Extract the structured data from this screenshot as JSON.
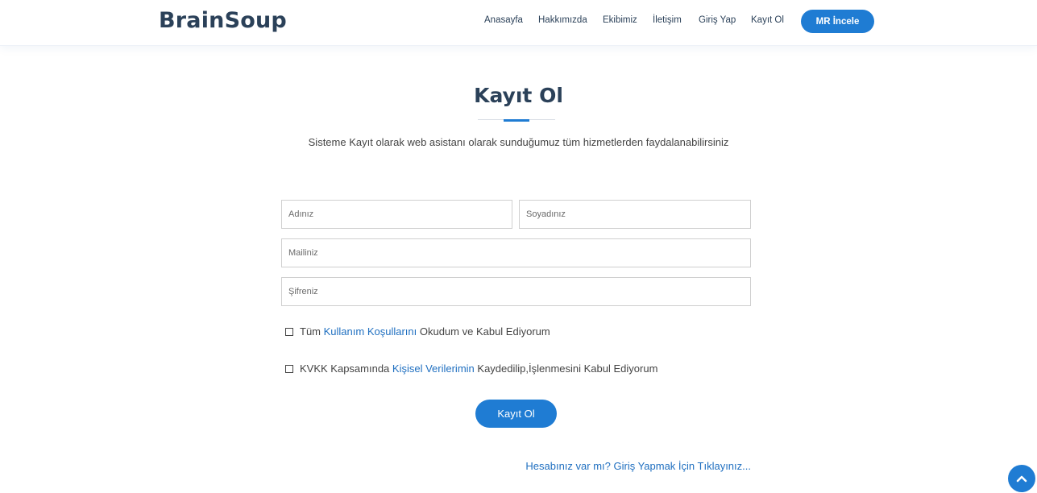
{
  "header": {
    "logo": "BrainSoup",
    "nav": [
      "Anasayfa",
      "Hakkımızda",
      "Ekibimiz",
      "İletişim",
      "Giriş Yap",
      "Kayıt Ol"
    ],
    "cta_label": "MR İncele"
  },
  "main": {
    "title": "Kayıt Ol",
    "subtitle": "Sisteme Kayıt olarak web asistanı olarak sunduğumuz tüm hizmetlerden faydalanabilirsiniz",
    "form": {
      "first_name_placeholder": "Adınız",
      "last_name_placeholder": "Soyadınız",
      "email_placeholder": "Mailiniz",
      "password_placeholder": "Şifreniz",
      "terms": {
        "prefix": "Tüm ",
        "link": "Kullanım Koşullarını",
        "suffix": " Okudum ve Kabul Ediyorum"
      },
      "kvkk": {
        "prefix": "KVKK Kapsamında ",
        "link": "Kişisel Verilerimin",
        "suffix": " Kaydedilip,İşlenmesini Kabul Ediyorum"
      },
      "submit_label": "Kayıt Ol",
      "login_link": "Hesabınız var mı? Giriş Yapmak İçin Tıklayınız..."
    }
  },
  "icons": {
    "back_to_top": "chevron-up-icon"
  },
  "colors": {
    "accent": "#1f7cd3",
    "heading": "#2b4159",
    "link": "#1f6fc0"
  }
}
